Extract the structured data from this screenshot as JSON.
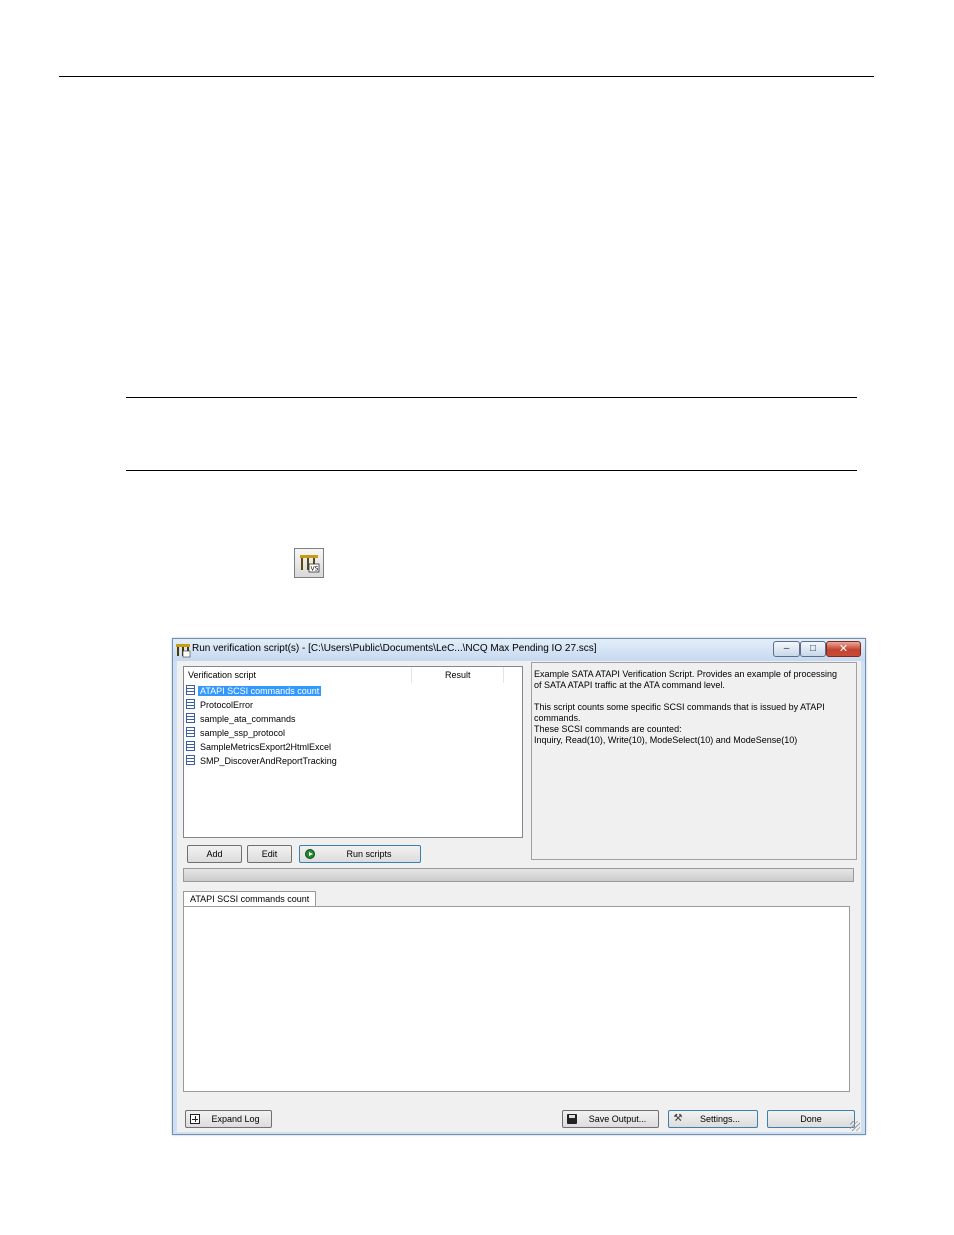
{
  "window": {
    "title": "Run verification script(s) - [C:\\Users\\Public\\Documents\\LeC...\\NCQ Max Pending IO 27.scs]",
    "caption_buttons": {
      "minimize": "–",
      "maximize": "□",
      "close": "✕"
    }
  },
  "script_list": {
    "columns": {
      "script": "Verification script",
      "result": "Result"
    },
    "items": [
      {
        "label": "ATAPI SCSI commands count",
        "selected": true
      },
      {
        "label": "ProtocolError"
      },
      {
        "label": "sample_ata_commands"
      },
      {
        "label": "sample_ssp_protocol"
      },
      {
        "label": "SampleMetricsExport2HtmlExcel"
      },
      {
        "label": "SMP_DiscoverAndReportTracking"
      }
    ]
  },
  "description": {
    "line1": "Example SATA ATAPI Verification Script. Provides an example of processing",
    "line2": "of SATA ATAPI traffic at the ATA command level.",
    "line3": "This script counts some specific SCSI commands that is issued by ATAPI commands.",
    "line4": "These SCSI commands are counted:",
    "line5": "Inquiry, Read(10), Write(10), ModeSelect(10) and ModeSense(10)"
  },
  "buttons": {
    "add": "Add",
    "edit": "Edit",
    "run": "Run scripts",
    "expand_log": "Expand Log",
    "save_output": "Save Output...",
    "settings": "Settings...",
    "done": "Done"
  },
  "log": {
    "tab_label": "ATAPI SCSI commands count",
    "content": ""
  },
  "icons": {
    "toolbar": "run-verification-scripts-icon",
    "script_item": "script-file-icon",
    "run": "play-icon",
    "expand": "expand-icon",
    "save": "floppy-disk-icon",
    "settings": "tools-icon"
  },
  "colors": {
    "selection": "#3399ff",
    "window_frame": "#cfe0f2",
    "close_button": "#c2432f"
  }
}
